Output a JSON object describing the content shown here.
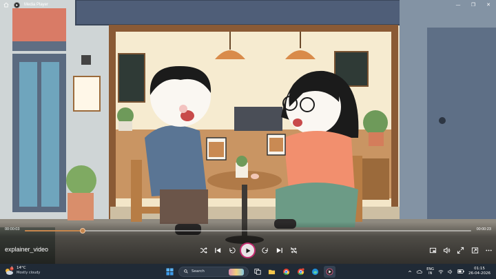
{
  "window": {
    "title": "Media Player",
    "minimize_glyph": "—",
    "maximize_glyph": "❐",
    "close_glyph": "✕"
  },
  "player": {
    "current_time": "00:00:03",
    "total_time": "00:00:23",
    "progress": 0.13,
    "video_title": "explainer_video",
    "accent_color": "#c7864d",
    "play_ring_color": "#c42b6f"
  },
  "icons": {
    "home": "home-icon",
    "shuffle": "shuffle-icon",
    "previous": "skip-previous-icon",
    "rewind": "rewind-10-icon",
    "play": "play-icon",
    "forward": "forward-30-icon",
    "next": "skip-next-icon",
    "repeat": "repeat-off-icon",
    "miniplayer": "miniplayer-icon",
    "volume": "volume-icon",
    "fullscreen": "fullscreen-icon",
    "cast": "cast-icon",
    "more": "more-options-icon"
  },
  "taskbar": {
    "weather_temp": "14°C",
    "weather_desc": "Mostly cloudy",
    "weather_badge": "1",
    "search_placeholder": "Search",
    "lang_line1": "ENG",
    "lang_line2": "IN",
    "time": "01:15",
    "date": "26-04-2026"
  }
}
